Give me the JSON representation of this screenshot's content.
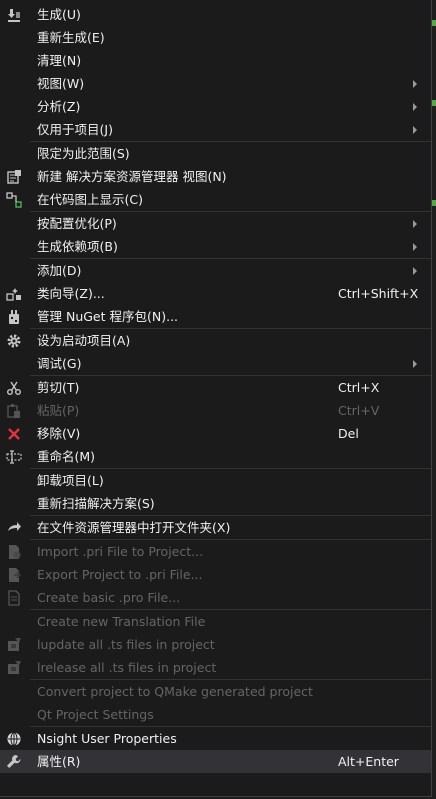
{
  "menu": {
    "groups": [
      [
        {
          "label": "生成(U)",
          "icon": "build-icon"
        },
        {
          "label": "重新生成(E)"
        },
        {
          "label": "清理(N)"
        },
        {
          "label": "视图(W)",
          "submenu": true
        },
        {
          "label": "分析(Z)",
          "submenu": true
        },
        {
          "label": "仅用于项目(J)",
          "submenu": true
        }
      ],
      [
        {
          "label": "限定为此范围(S)"
        },
        {
          "label": "新建 解决方案资源管理器 视图(N)",
          "icon": "new-view-icon"
        },
        {
          "label": "在代码图上显示(C)",
          "icon": "code-map-icon"
        }
      ],
      [
        {
          "label": "按配置优化(P)",
          "submenu": true
        },
        {
          "label": "生成依赖项(B)",
          "submenu": true
        }
      ],
      [
        {
          "label": "添加(D)",
          "submenu": true
        },
        {
          "label": "类向导(Z)...",
          "shortcut": "Ctrl+Shift+X",
          "icon": "class-wizard-icon"
        },
        {
          "label": "管理 NuGet 程序包(N)...",
          "icon": "nuget-icon"
        }
      ],
      [
        {
          "label": "设为启动项目(A)",
          "icon": "gear-icon"
        },
        {
          "label": "调试(G)",
          "submenu": true
        }
      ],
      [
        {
          "label": "剪切(T)",
          "shortcut": "Ctrl+X",
          "icon": "scissors-icon"
        },
        {
          "label": "粘贴(P)",
          "shortcut": "Ctrl+V",
          "icon": "paste-icon",
          "disabled": true
        },
        {
          "label": "移除(V)",
          "shortcut": "Del",
          "icon": "remove-icon"
        },
        {
          "label": "重命名(M)",
          "icon": "rename-icon"
        }
      ],
      [
        {
          "label": "卸载项目(L)"
        },
        {
          "label": "重新扫描解决方案(S)"
        }
      ],
      [
        {
          "label": "在文件资源管理器中打开文件夹(X)",
          "icon": "open-folder-icon"
        }
      ],
      [
        {
          "label": "Import .pri File to Project...",
          "icon": "qt-import-icon",
          "disabled": true
        },
        {
          "label": "Export Project to .pri File...",
          "icon": "qt-export-icon",
          "disabled": true
        },
        {
          "label": "Create basic .pro File...",
          "icon": "qt-pro-file-icon",
          "disabled": true
        }
      ],
      [
        {
          "label": "Create new Translation File",
          "disabled": true
        },
        {
          "label": "lupdate all .ts files in project",
          "icon": "qt-lupdate-icon",
          "disabled": true
        },
        {
          "label": "lrelease all .ts files in project",
          "icon": "qt-lrelease-icon",
          "disabled": true
        }
      ],
      [
        {
          "label": "Convert project to QMake generated project",
          "disabled": true
        },
        {
          "label": "Qt Project Settings",
          "disabled": true
        }
      ],
      [
        {
          "label": "Nsight User Properties",
          "icon": "nsight-icon"
        },
        {
          "label": "属性(R)",
          "shortcut": "Alt+Enter",
          "icon": "wrench-icon",
          "selected": true
        }
      ]
    ]
  }
}
